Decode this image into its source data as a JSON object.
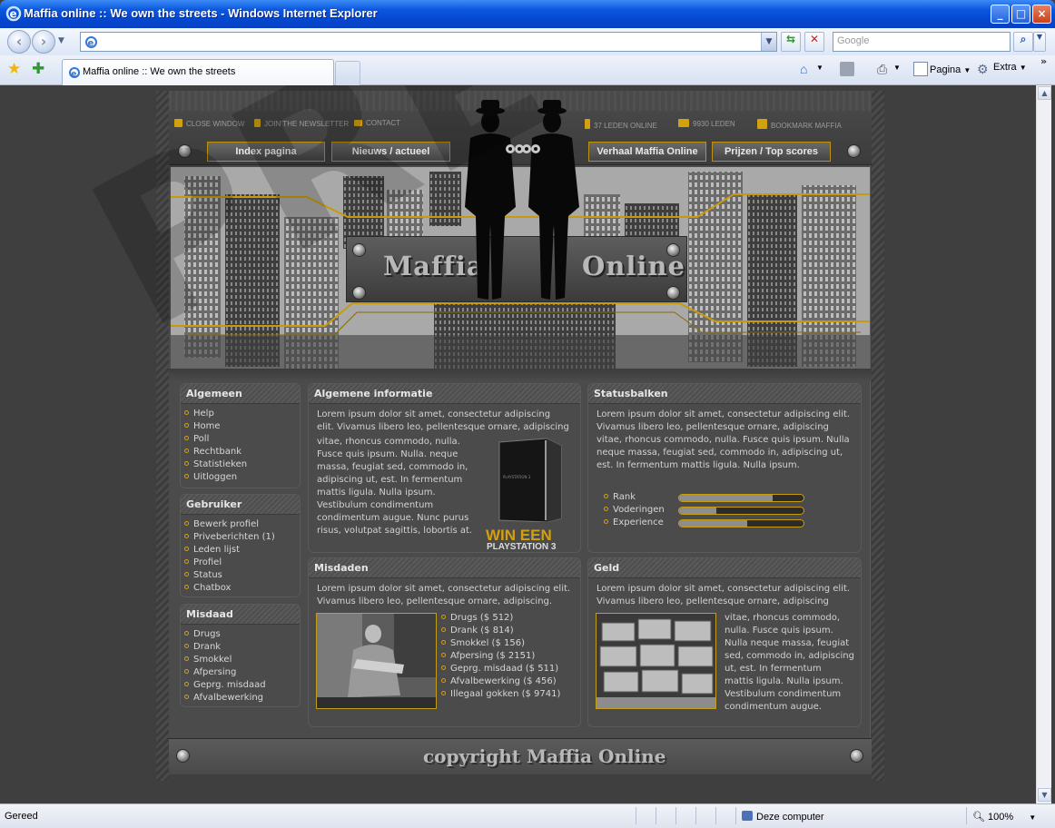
{
  "window": {
    "title": "Maffia online :: We own the streets - Windows Internet Explorer"
  },
  "address": {
    "value": ""
  },
  "search": {
    "placeholder": "Google"
  },
  "tab": {
    "label": "Maffia online :: We own the streets"
  },
  "commands": {
    "page": "Pagina",
    "tools": "Extra"
  },
  "status": {
    "left": "Gereed",
    "zone": "Deze computer",
    "zoom": "100%"
  },
  "watermark": "PREVIEW",
  "site": {
    "toplinks": [
      {
        "label": "CLOSE WINDOW"
      },
      {
        "label": "JOIN THE NEWSLETTER"
      },
      {
        "label": "CONTACT"
      },
      {
        "label": "37 LEDEN ONLINE"
      },
      {
        "label": "9930 LEDEN"
      },
      {
        "label": "BOOKMARK MAFFIA"
      }
    ],
    "nav": [
      "Index pagina",
      "Nieuws / actueel",
      "Verhaal Maffia Online",
      "Prijzen / Top scores"
    ],
    "logo": {
      "left": "Maffia",
      "right": "Online"
    },
    "sidebar": {
      "algemeen": {
        "title": "Algemeen",
        "items": [
          "Help",
          "Home",
          "Poll",
          "Rechtbank",
          "Statistieken",
          "Uitloggen"
        ]
      },
      "gebruiker": {
        "title": "Gebruiker",
        "items": [
          "Bewerk profiel",
          "Priveberichten (1)",
          "Leden lijst",
          "Profiel",
          "Status",
          "Chatbox"
        ]
      },
      "misdaad": {
        "title": "Misdaad",
        "items": [
          "Drugs",
          "Drank",
          "Smokkel",
          "Afpersing",
          "Geprg. misdaad",
          "Afvalbewerking"
        ]
      }
    },
    "info": {
      "title": "Algemene informatie",
      "p1": "Lorem ipsum dolor sit amet, consectetur adipiscing elit. Vivamus libero leo, pellentesque ornare, adipiscing",
      "p2": [
        "vitae, rhoncus commodo, nulla.",
        "Fusce quis ipsum. Nulla. neque",
        "massa, feugiat sed, commodo in,",
        "adipiscing ut, est. In fermentum",
        "mattis ligula. Nulla ipsum.",
        "Vestibulum condimentum",
        "condimentum augue. Nunc purus",
        "risus, volutpat sagittis, lobortis at."
      ],
      "promo1": "WIN EEN",
      "promo2": "PLAYSTATION 3",
      "console_label": "PLAYSTATION 3"
    },
    "status": {
      "title": "Statusbalken",
      "p": "Lorem ipsum dolor sit amet, consectetur adipiscing elit. Vivamus libero leo, pellentesque ornare, adipiscing vitae, rhoncus commodo, nulla. Fusce quis ipsum. Nulla neque massa, feugiat sed, commodo in, adipiscing ut, est. In fermentum mattis ligula. Nulla ipsum.",
      "bars": [
        {
          "label": "Rank",
          "value": 0.75
        },
        {
          "label": "Voderingen",
          "value": 0.3
        },
        {
          "label": "Experience",
          "value": 0.55
        }
      ]
    },
    "misdaden": {
      "title": "Misdaden",
      "p": "Lorem ipsum dolor sit amet, consectetur adipiscing elit. Vivamus libero leo, pellentesque ornare, adipiscing.",
      "items": [
        "Drugs ($ 512)",
        "Drank ($ 814)",
        "Smokkel ($ 156)",
        "Afpersing ($ 2151)",
        "Geprg. misdaad ($ 511)",
        "Afvalbewerking ($ 456)",
        "Illegaal gokken ($ 9741)"
      ]
    },
    "geld": {
      "title": "Geld",
      "p1": "Lorem ipsum dolor sit amet, consectetur adipiscing elit. Vivamus libero leo, pellentesque ornare, adipiscing",
      "p2": [
        "vitae, rhoncus commodo,",
        "nulla. Fusce quis ipsum.",
        "Nulla neque massa, feugiat",
        "sed, commodo in, adipiscing",
        "ut, est. In fermentum",
        "mattis ligula. Nulla ipsum.",
        "Vestibulum condimentum",
        "condimentum augue."
      ]
    },
    "footer": "copyright Maffia Online"
  },
  "colors": {
    "accent": "#d4a00f",
    "bg": "#4b4b4b",
    "titlebar": "#0a57de"
  }
}
